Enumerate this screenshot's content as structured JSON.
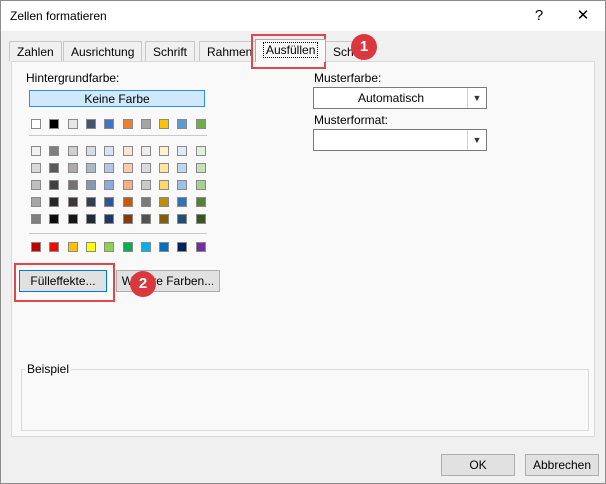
{
  "window": {
    "title": "Zellen formatieren",
    "help_glyph": "?",
    "close_glyph": "✕"
  },
  "tabs": [
    "Zahlen",
    "Ausrichtung",
    "Schrift",
    "Rahmen",
    "Ausfüllen",
    "Sch"
  ],
  "active_tab": "Ausfüllen",
  "fill": {
    "background_label": "Hintergrundfarbe:",
    "no_color_label": "Keine Farbe",
    "fill_effects_label": "Fülleffekte...",
    "more_colors_label": "Weitere Farben...",
    "more_colors_visible": "W      re Farben..."
  },
  "pattern": {
    "color_label": "Musterfarbe:",
    "color_value": "Automatisch",
    "style_label": "Musterformat:",
    "style_value": ""
  },
  "sample": {
    "label": "Beispiel"
  },
  "footer": {
    "ok_label": "OK",
    "cancel_label": "Abbrechen"
  },
  "annotations": {
    "badge_1": "1",
    "badge_2": "2"
  },
  "colors": {
    "theme_row": [
      "#ffffff",
      "#000000",
      "#e7e6e6",
      "#44546a",
      "#4472c4",
      "#ed7d31",
      "#a5a5a5",
      "#ffc000",
      "#5b9bd5",
      "#70ad47"
    ],
    "shade_rows": [
      [
        "#f2f2f2",
        "#7f7f7f",
        "#d0cece",
        "#d6dce4",
        "#d9e1f2",
        "#fce4d6",
        "#ededed",
        "#fff2cc",
        "#ddebf7",
        "#e2efda"
      ],
      [
        "#d9d9d9",
        "#595959",
        "#aeaaaa",
        "#acb9ca",
        "#b4c6e7",
        "#f8cbad",
        "#dbdbdb",
        "#ffe699",
        "#bdd7ee",
        "#c6e0b4"
      ],
      [
        "#bfbfbf",
        "#404040",
        "#757171",
        "#8497b0",
        "#8ea9db",
        "#f4b084",
        "#c9c9c9",
        "#ffd966",
        "#9bc2e6",
        "#a9d08e"
      ],
      [
        "#a6a6a6",
        "#262626",
        "#3a3838",
        "#333f4f",
        "#305496",
        "#c65911",
        "#7b7b7b",
        "#bf8f00",
        "#2f75b5",
        "#548235"
      ],
      [
        "#808080",
        "#0d0d0d",
        "#161616",
        "#222b35",
        "#203764",
        "#833c0c",
        "#525252",
        "#806000",
        "#1f4e78",
        "#375623"
      ]
    ],
    "standard_row": [
      "#c00000",
      "#ff0000",
      "#ffc000",
      "#ffff00",
      "#92d050",
      "#00b050",
      "#00b0f0",
      "#0070c0",
      "#002060",
      "#7030a0"
    ],
    "highlight": "#e0474c",
    "badge": "#d9383e",
    "selection": "#cfe8fc"
  }
}
